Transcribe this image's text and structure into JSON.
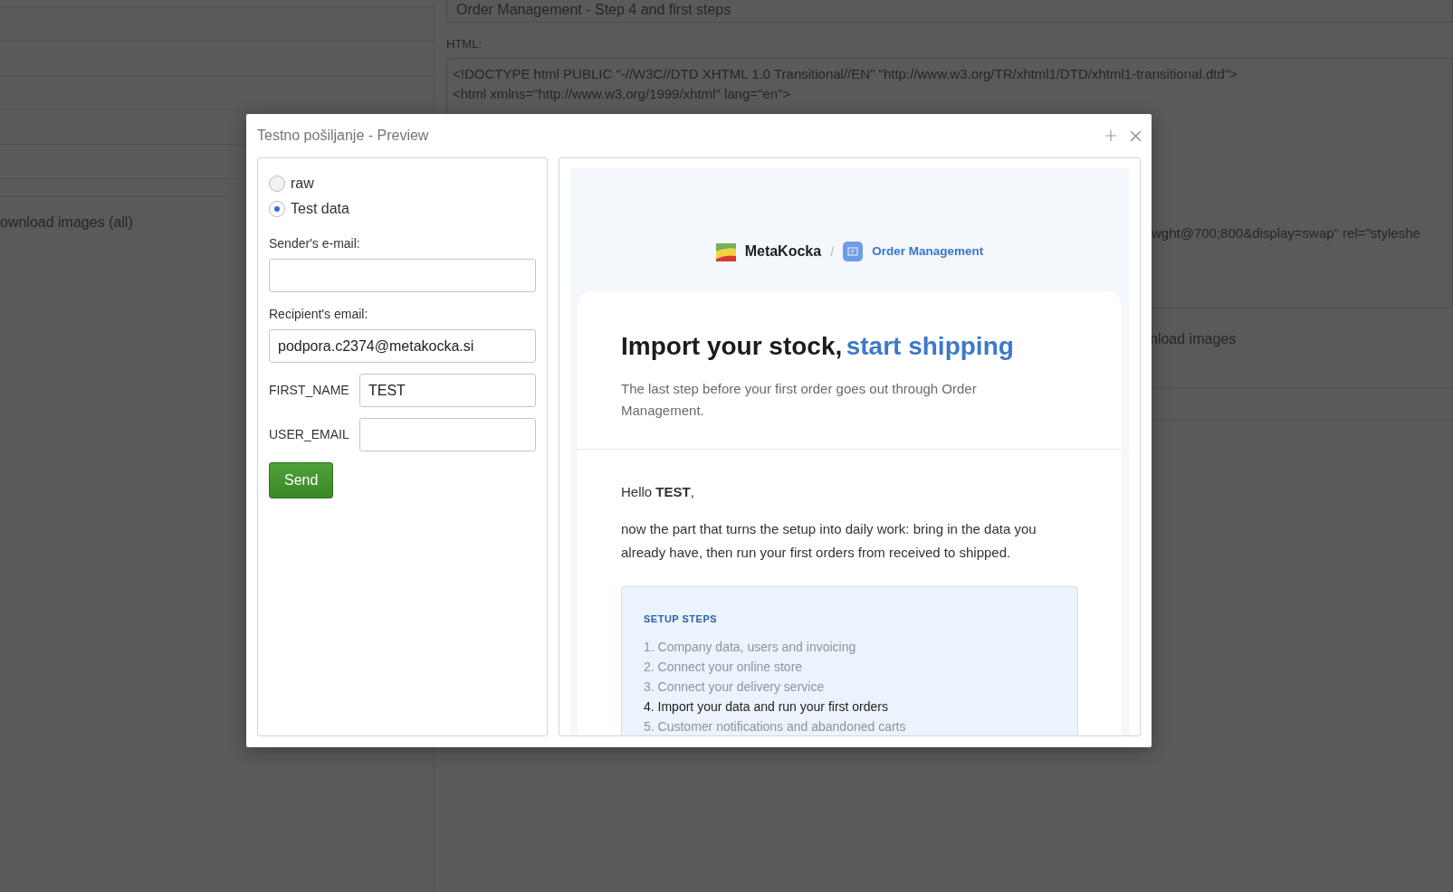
{
  "background": {
    "subject_field": {
      "value": "Order Management - Step 4 and first steps"
    },
    "html_label": "HTML:",
    "html_lines": [
      "<!DOCTYPE html PUBLIC \"-//W3C//DTD XHTML 1.0 Transitional//EN\" \"http://www.w3.org/TR/xhtml1/DTD/xhtml1-transitional.dtd\">",
      "<html xmlns=\"http://www.w3.org/1999/xhtml\" lang=\"en\">"
    ],
    "html_fragment": "wght@700;800&display=swap\" rel=\"styleshe",
    "left_link": "ownload images (all)",
    "right_link": "nload images"
  },
  "modal": {
    "title": "Testno pošiljanje - Preview",
    "form": {
      "modes": [
        {
          "label": "raw",
          "selected": false
        },
        {
          "label": "Test data",
          "selected": true
        }
      ],
      "sender": {
        "label": "Sender's e-mail:"
      },
      "recipient": {
        "label": "Recipient's email:",
        "value": "podpora.c2374@metakocka.si"
      },
      "variables": [
        {
          "name": "FIRST_NAME",
          "value": "TEST"
        },
        {
          "name": "USER_EMAIL"
        }
      ],
      "send_button": "Send"
    },
    "preview": {
      "brand": "MetaKocka",
      "separator": "/",
      "product": "Order Management",
      "heading_lead": "Import your stock,",
      "heading_accent": "start shipping",
      "subtitle": "The last step before your first order goes out through Order Management.",
      "greeting": "Hello **TEST**,",
      "intro": "now the part that turns the setup into daily work: bring in the data you already have, then run your first orders from received to shipped.",
      "steps": {
        "title": "SETUP STEPS",
        "items": [
          {
            "label": "1. Company data, users and invoicing",
            "selected": false
          },
          {
            "label": "2. Connect your online store",
            "selected": false
          },
          {
            "label": "3. Connect your delivery service",
            "selected": false
          },
          {
            "label": "4. Import your data and run your first orders",
            "selected": true
          },
          {
            "label": "5. Customer notifications and abandoned carts",
            "selected": false
          }
        ]
      }
    }
  }
}
